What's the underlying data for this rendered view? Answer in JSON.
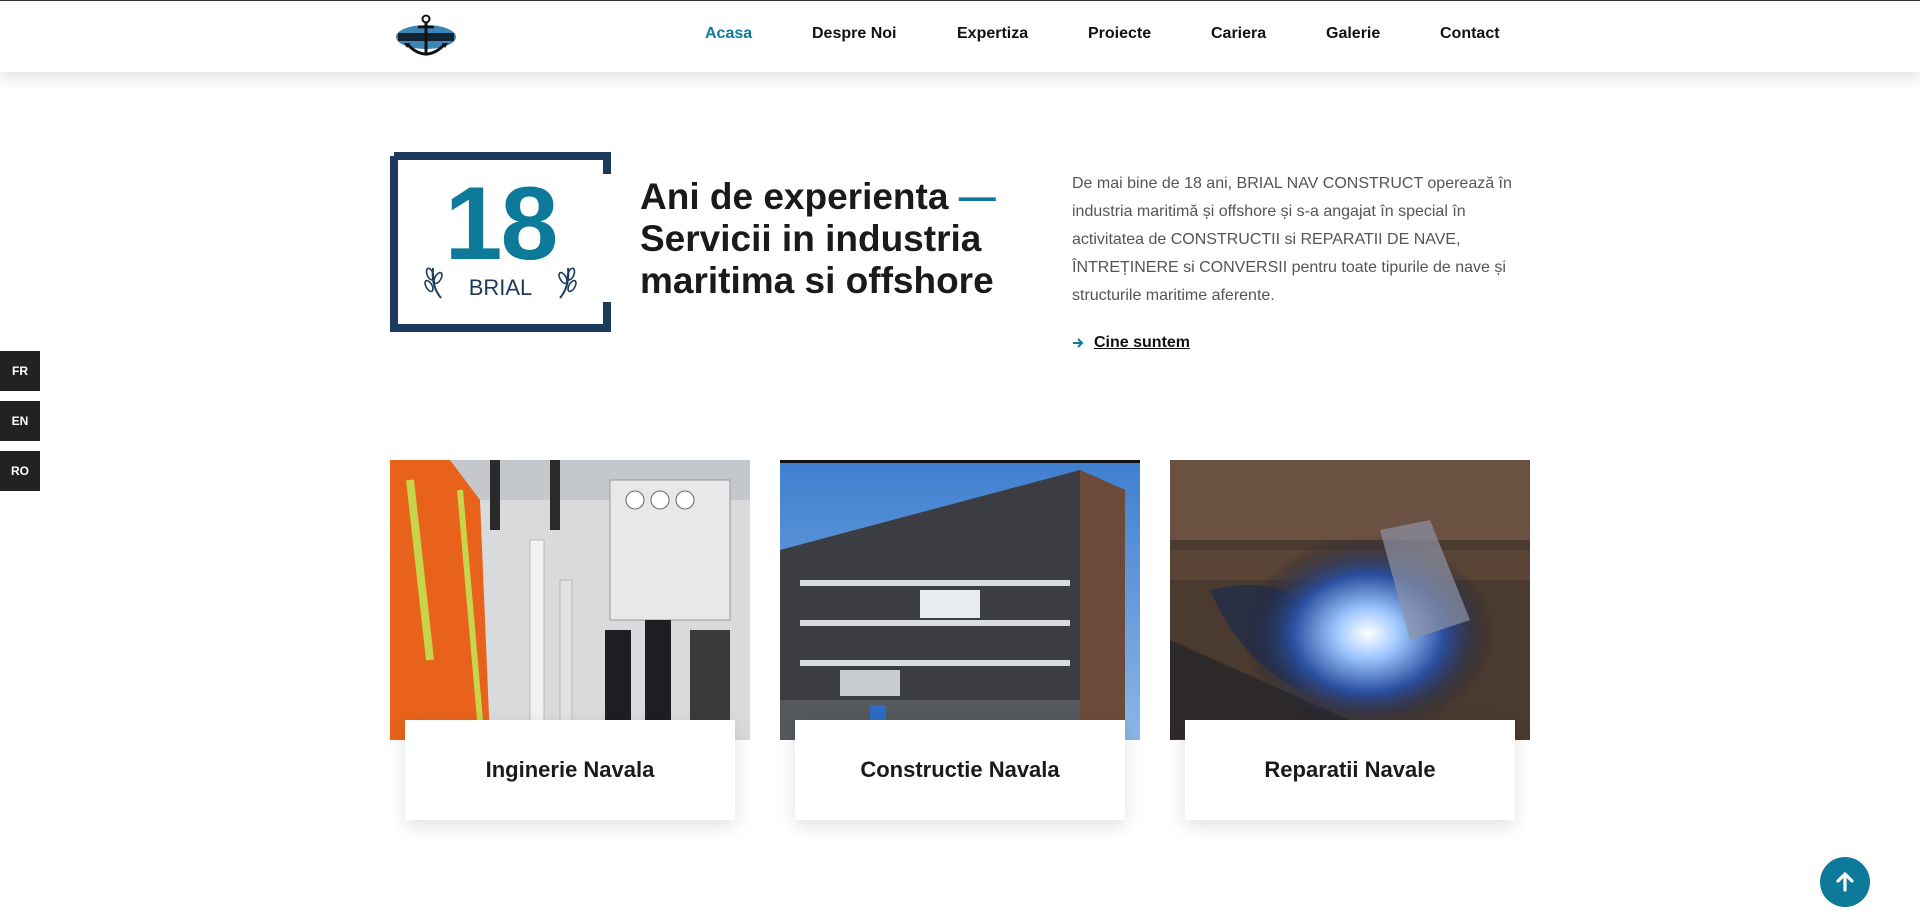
{
  "header": {
    "logo_icon": "anchor-logo-icon",
    "nav": [
      {
        "label": "Acasa",
        "active": true
      },
      {
        "label": "Despre Noi",
        "active": false
      },
      {
        "label": "Expertiza",
        "active": false
      },
      {
        "label": "Proiecte",
        "active": false
      },
      {
        "label": "Cariera",
        "active": false
      },
      {
        "label": "Galerie",
        "active": false
      },
      {
        "label": "Contact",
        "active": false
      }
    ]
  },
  "languages": [
    "FR",
    "EN",
    "RO"
  ],
  "hero": {
    "badge_number": "18",
    "badge_label": "BRIAL",
    "title_line1": "Ani de experienta",
    "title_dash": "—",
    "title_rest": "Servicii in industria maritima si offshore",
    "description": "De mai bine de 18 ani, BRIAL NAV CONSTRUCT operează în industria maritimă și offshore și s-a angajat în special în activitatea de CONSTRUCTII si REPARATII DE NAVE, ÎNTREȚINERE si CONVERSII pentru toate tipurile de nave și structurile maritime aferente.",
    "link_label": "Cine suntem"
  },
  "cards": [
    {
      "label": "Inginerie Navala"
    },
    {
      "label": "Constructie Navala"
    },
    {
      "label": "Reparatii Navale"
    }
  ],
  "colors": {
    "accent": "#0e7a99",
    "navy": "#1c3a5e",
    "lang_bg": "#222222"
  },
  "icons": {
    "link_arrow": "arrow-right-icon",
    "back_to_top": "arrow-up-icon",
    "wheat": "wheat-icon"
  }
}
